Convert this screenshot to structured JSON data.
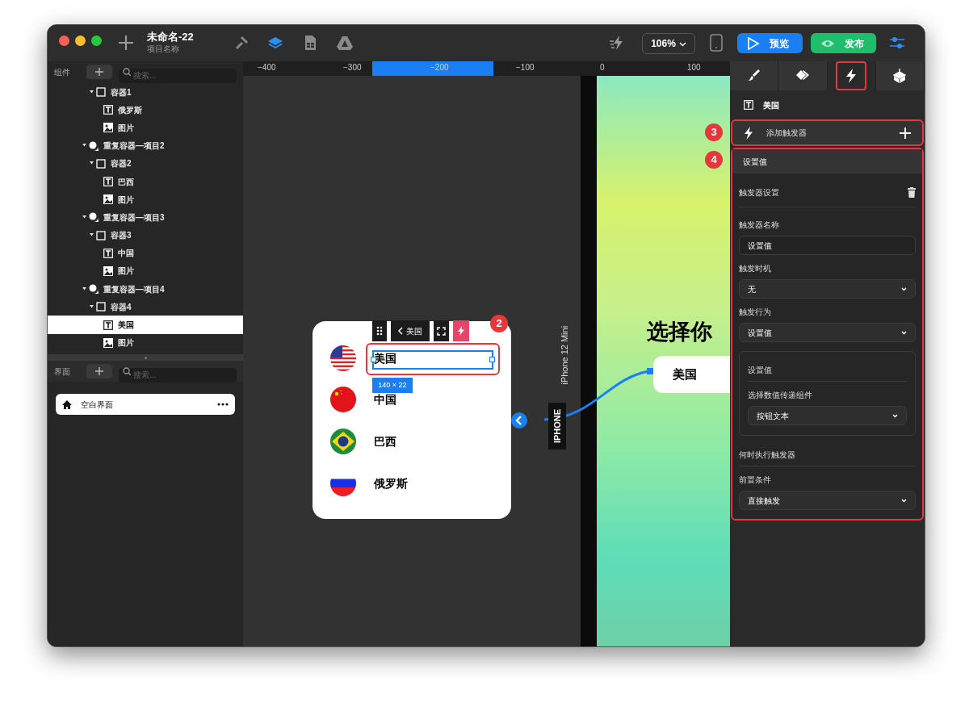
{
  "window": {
    "title": "未命名-22",
    "subtitle": "项目名称"
  },
  "toolbar": {
    "modes": [
      {
        "kind": "hammer",
        "selected": false
      },
      {
        "kind": "layers",
        "selected": true
      },
      {
        "kind": "sheet",
        "selected": false
      },
      {
        "kind": "triangle",
        "selected": false
      }
    ],
    "zoom": "106%",
    "preview_button": "预览",
    "publish_button": "发布"
  },
  "left_panel": {
    "components": {
      "label": "组件",
      "search_placeholder": "搜索...",
      "tree": [
        {
          "children": [
            {
              "kind": "container",
              "label": "容器1",
              "expanded": true,
              "selected": false,
              "children": [
                {
                  "kind": "text",
                  "label": "俄罗斯",
                  "selected": false
                },
                {
                  "kind": "image",
                  "label": "图片",
                  "selected": false
                }
              ]
            }
          ]
        },
        {
          "kind": "repeat",
          "label": "重复容器—项目2",
          "expanded": true,
          "selected": false,
          "children": [
            {
              "kind": "container",
              "label": "容器2",
              "expanded": true,
              "selected": false,
              "children": [
                {
                  "kind": "text",
                  "label": "巴西",
                  "selected": false
                },
                {
                  "kind": "image",
                  "label": "图片",
                  "selected": false
                }
              ]
            }
          ]
        },
        {
          "kind": "repeat",
          "label": "重复容器—项目3",
          "expanded": true,
          "selected": false,
          "children": [
            {
              "kind": "container",
              "label": "容器3",
              "expanded": true,
              "selected": false,
              "children": [
                {
                  "kind": "text",
                  "label": "中国",
                  "selected": false
                },
                {
                  "kind": "image",
                  "label": "图片",
                  "selected": false
                }
              ]
            }
          ]
        },
        {
          "kind": "repeat",
          "label": "重复容器—项目4",
          "expanded": true,
          "selected": false,
          "children": [
            {
              "kind": "container",
              "label": "容器4",
              "expanded": true,
              "selected": false,
              "children": [
                {
                  "kind": "text",
                  "label": "美国",
                  "selected": true
                },
                {
                  "kind": "image",
                  "label": "图片",
                  "selected": false
                }
              ]
            }
          ]
        }
      ]
    },
    "screens": {
      "label": "界面",
      "search_placeholder": "搜索...",
      "items": [
        {
          "label": "空白界面",
          "selected": true
        }
      ]
    }
  },
  "canvas": {
    "ruler": [
      "−400",
      "−300",
      "−200",
      "−100",
      "0",
      "100"
    ],
    "component_card": {
      "toolbar_label": "美国",
      "size_tag": "140 × 22",
      "badge": "2",
      "rows": [
        {
          "kind": "us",
          "label": "美国"
        },
        {
          "kind": "cn",
          "label": "中国"
        },
        {
          "kind": "br",
          "label": "巴西"
        },
        {
          "kind": "ru",
          "label": "俄罗斯"
        }
      ]
    },
    "device": {
      "name": "iPhone 12 Mini",
      "tab": "IPHONE",
      "heading": "选择你",
      "button": "美国"
    },
    "badges": [
      "3",
      "4"
    ]
  },
  "right_panel": {
    "tabs": [
      {
        "kind": "brush",
        "selected": false
      },
      {
        "kind": "diamond",
        "selected": false
      },
      {
        "kind": "lightning",
        "selected": true
      },
      {
        "kind": "cube",
        "selected": false
      }
    ],
    "element": {
      "kind": "text",
      "label": "美国"
    },
    "add_trigger": "添加触发器",
    "trigger": {
      "title": "设置值",
      "settings_label": "触发器设置",
      "name_label": "触发器名称",
      "name_value": "设置值",
      "timing_label": "触发时机",
      "timing_value": "无",
      "action_label": "触发行为",
      "action_value": "设置值",
      "action_box": {
        "title": "设置值",
        "component_label": "选择数值传递组件",
        "component_value": "按钮文本"
      },
      "when_label": "何时执行触发器",
      "condition_label": "前置条件",
      "condition_value": "直接触发"
    }
  }
}
